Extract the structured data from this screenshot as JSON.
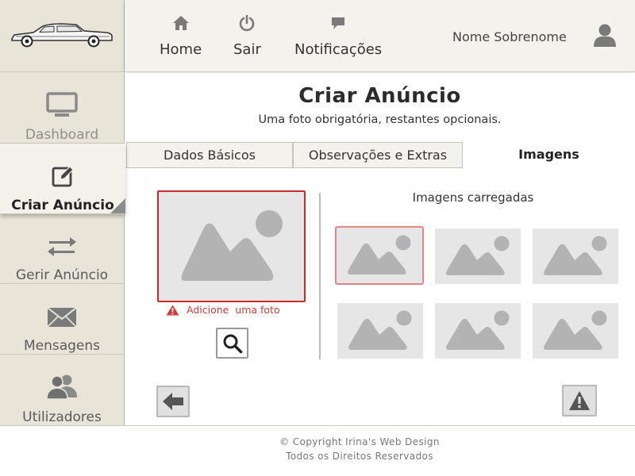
{
  "header": {
    "nav": [
      {
        "label": "Home",
        "icon": "home-icon"
      },
      {
        "label": "Sair",
        "icon": "power-icon"
      },
      {
        "label": "Notificações",
        "icon": "chat-bubble-icon"
      }
    ],
    "user_name": "Nome Sobrenome",
    "user_icon": "user-icon"
  },
  "sidebar": {
    "logo_icon": "car-logo-icon",
    "items": [
      {
        "label": "Dashboard",
        "icon": "monitor-icon",
        "state": "disabled"
      },
      {
        "label": "Criar Anúncio",
        "icon": "edit-icon",
        "state": "active"
      },
      {
        "label": "Gerir Anúncio",
        "icon": "swap-arrows-icon",
        "state": "normal"
      },
      {
        "label": "Mensagens",
        "icon": "envelope-icon",
        "state": "normal"
      },
      {
        "label": "Utilizadores",
        "icon": "users-icon",
        "state": "normal"
      }
    ]
  },
  "main": {
    "title": "Criar Anúncio",
    "subtitle": "Uma foto obrigatória, restantes opcionais.",
    "tabs": [
      {
        "label": "Dados Básicos",
        "active": false
      },
      {
        "label": "Observações e Extras",
        "active": false
      },
      {
        "label": "Imagens",
        "active": true
      }
    ],
    "upload": {
      "error_text": "Adicione  uma foto",
      "search_icon": "search-icon"
    },
    "loaded_title": "Imagens carregadas",
    "thumbnails_count_visible": 6
  },
  "footer": {
    "copyright": "© Copyright Irina's Web Design",
    "rights": "Todos os Direitos Reservados"
  },
  "colors": {
    "sidebar_bg": "#e8e5d8",
    "header_bg": "#f4f2ec",
    "error_red": "#cc2a2a",
    "placeholder_gray": "#b3b3b3",
    "icon_gray": "#7a7a7a"
  }
}
